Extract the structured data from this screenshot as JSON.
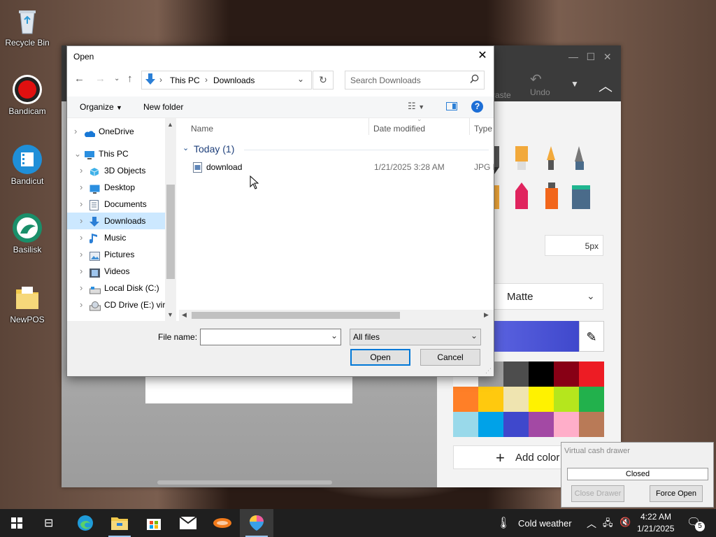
{
  "desktop": {
    "icons": [
      {
        "label": "Recycle Bin",
        "icon": "recycle-bin-icon"
      },
      {
        "label": "Bandicam",
        "icon": "bandicam-icon"
      },
      {
        "label": "Bandicut",
        "icon": "bandicut-icon"
      },
      {
        "label": "Basilisk",
        "icon": "basilisk-icon"
      },
      {
        "label": "NewPOS",
        "icon": "folder-icon"
      }
    ]
  },
  "paint": {
    "toolbar": {
      "paste": "Paste",
      "undo": "Undo"
    },
    "size": "5px",
    "finish": "Matte",
    "add_color": "Add color",
    "colors": [
      "#ffffff",
      "#a0a0a0",
      "#4d4d4d",
      "#000000",
      "#880015",
      "#ed1c24",
      "#ff7f27",
      "#ffc90e",
      "#efe4b0",
      "#fff200",
      "#b5e61d",
      "#22b14c",
      "#99d9ea",
      "#00a2e8",
      "#3f48cc",
      "#a349a4",
      "#ffaec9",
      "#b97a57"
    ],
    "active_color": "#3f48cc"
  },
  "dialog": {
    "title": "Open",
    "close": "✕",
    "address": {
      "segments": [
        "This PC",
        "Downloads"
      ],
      "separator": "›"
    },
    "search_placeholder": "Search Downloads",
    "toolbar": {
      "organize": "Organize",
      "new_folder": "New folder",
      "help": "?"
    },
    "nav_tree": [
      {
        "label": "OneDrive",
        "indent": 0,
        "icon": "onedrive-icon",
        "selected": false
      },
      {
        "label": "This PC",
        "indent": 0,
        "icon": "this-pc-icon",
        "selected": false,
        "expanded": true
      },
      {
        "label": "3D Objects",
        "indent": 1,
        "icon": "3d-objects-icon",
        "selected": false
      },
      {
        "label": "Desktop",
        "indent": 1,
        "icon": "desktop-icon",
        "selected": false
      },
      {
        "label": "Documents",
        "indent": 1,
        "icon": "documents-icon",
        "selected": false
      },
      {
        "label": "Downloads",
        "indent": 1,
        "icon": "downloads-icon",
        "selected": true
      },
      {
        "label": "Music",
        "indent": 1,
        "icon": "music-icon",
        "selected": false
      },
      {
        "label": "Pictures",
        "indent": 1,
        "icon": "pictures-icon",
        "selected": false
      },
      {
        "label": "Videos",
        "indent": 1,
        "icon": "videos-icon",
        "selected": false
      },
      {
        "label": "Local Disk (C:)",
        "indent": 1,
        "icon": "local-disk-icon",
        "selected": false
      },
      {
        "label": "CD Drive (E:) virt",
        "indent": 1,
        "icon": "cd-drive-icon",
        "selected": false
      }
    ],
    "columns": {
      "name": "Name",
      "date": "Date modified",
      "type": "Type"
    },
    "groups": [
      {
        "label": "Today (1)",
        "files": [
          {
            "name": "download",
            "date": "1/21/2025 3:28 AM",
            "type": "JPG F"
          }
        ]
      }
    ],
    "filename_label": "File name:",
    "filename_value": "",
    "filetype": "All files",
    "open_button": "Open",
    "cancel_button": "Cancel"
  },
  "cash_drawer": {
    "title": "Virtual cash drawer",
    "status": "Closed",
    "close_button": "Close Drawer",
    "force_button": "Force Open"
  },
  "taskbar": {
    "weather": "Cold weather",
    "time": "4:22 AM",
    "date": "1/21/2025",
    "notifications": "5"
  }
}
